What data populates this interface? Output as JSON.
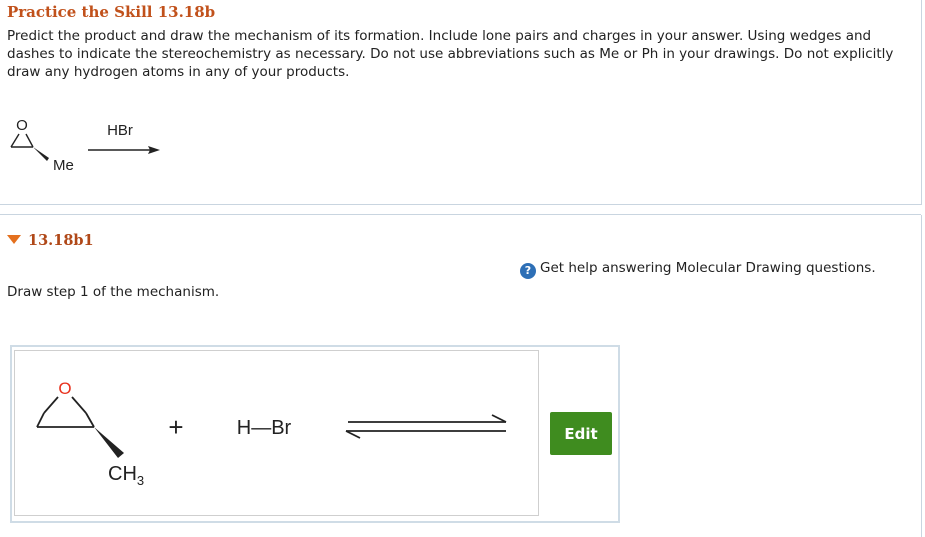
{
  "practice": {
    "title": "Practice the Skill 13.18b",
    "instructions": "Predict the product and draw the mechanism of its formation. Include lone pairs and charges in your answer. Using wedges and dashes to indicate the stereochemistry as necessary. Do not use abbreviations such as Me or Ph in your drawings. Do not explicitly draw any hydrogen atoms in any of your products.",
    "reaction": {
      "oxygen": "O",
      "substituent": "Me",
      "reagent": "HBr"
    }
  },
  "part": {
    "label": "13.18b1",
    "help_text": "Get help answering Molecular Drawing questions.",
    "help_icon": "question-circle-icon",
    "prompt": "Draw step 1 of the mechanism.",
    "drawing": {
      "oxygen": "O",
      "methyl": "CH",
      "methyl_sub": "3",
      "plus": "+",
      "reagent": "H—Br"
    },
    "edit_label": "Edit"
  },
  "colors": {
    "title": "#c1511b",
    "oxygen": "#e8321e",
    "edit_button": "#3f8c1f",
    "help_icon": "#2d6fb6"
  }
}
